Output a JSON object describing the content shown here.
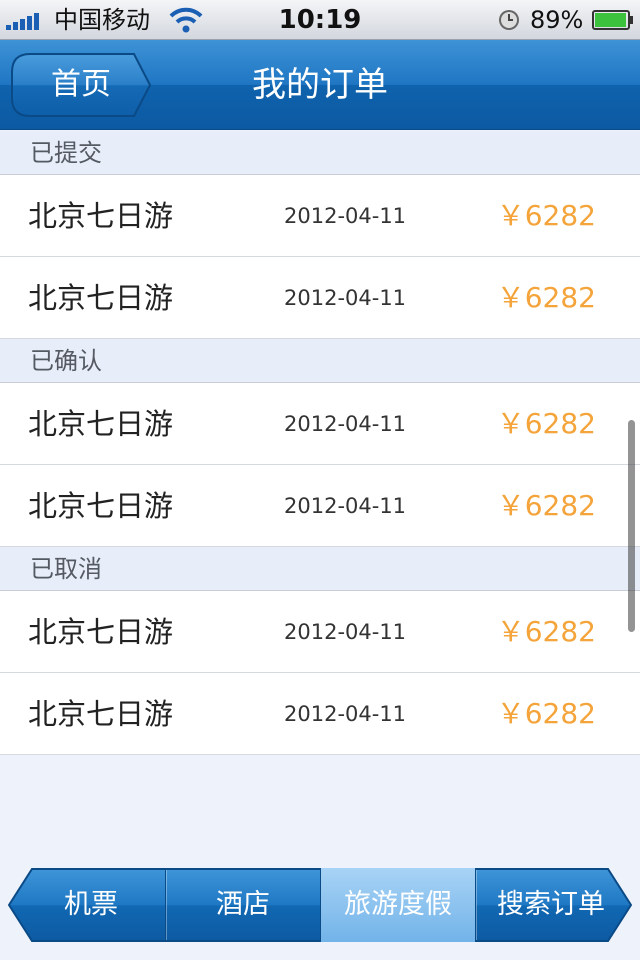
{
  "status_bar": {
    "carrier": "中国移动",
    "time": "10:19",
    "battery_percent": "89%",
    "icons": [
      "signal-icon",
      "wifi-icon",
      "clock-icon",
      "battery-icon"
    ]
  },
  "nav": {
    "back_label": "首页",
    "title": "我的订单"
  },
  "sections": [
    {
      "header": "已提交",
      "rows": [
        {
          "name": "北京七日游",
          "date": "2012-04-11",
          "price": "￥6282"
        },
        {
          "name": "北京七日游",
          "date": "2012-04-11",
          "price": "￥6282"
        }
      ]
    },
    {
      "header": "已确认",
      "rows": [
        {
          "name": "北京七日游",
          "date": "2012-04-11",
          "price": "￥6282"
        },
        {
          "name": "北京七日游",
          "date": "2012-04-11",
          "price": "￥6282"
        }
      ]
    },
    {
      "header": "已取消",
      "rows": [
        {
          "name": "北京七日游",
          "date": "2012-04-11",
          "price": "￥6282"
        },
        {
          "name": "北京七日游",
          "date": "2012-04-11",
          "price": "￥6282"
        }
      ]
    }
  ],
  "tabs": [
    {
      "label": "机票",
      "active": false
    },
    {
      "label": "酒店",
      "active": false
    },
    {
      "label": "旅游度假",
      "active": true
    },
    {
      "label": "搜索订单",
      "active": false
    }
  ],
  "colors": {
    "nav_blue": "#1f76c3",
    "price_orange": "#f4a43a",
    "section_bg": "#e7edf9"
  }
}
